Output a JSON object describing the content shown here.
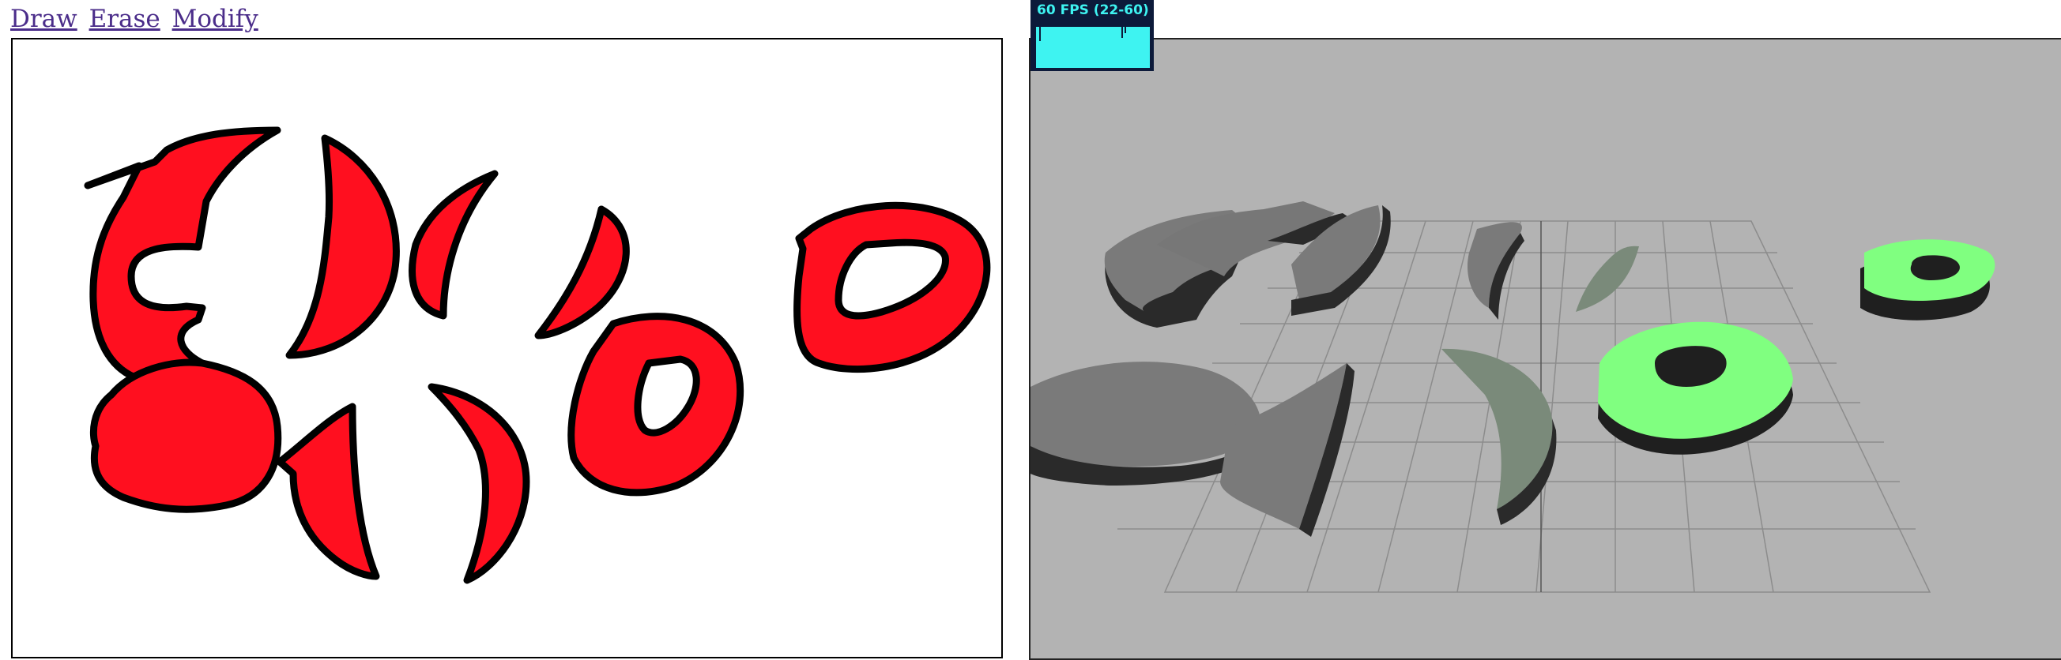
{
  "toolbar": {
    "draw_label": "Draw",
    "erase_label": "Erase",
    "modify_label": "Modify"
  },
  "fps_meter": {
    "text": "60 FPS (22-60)"
  },
  "colors": {
    "shape_fill_2d": "#ff0f1f",
    "shape_stroke_2d": "#000000",
    "scene_background": "#b3b3b3",
    "extruded_gray": "#7a7a7a",
    "extruded_selected": "#80ff80",
    "fps_bg": "#0c1a3a",
    "fps_fg": "#3ef3f1"
  }
}
